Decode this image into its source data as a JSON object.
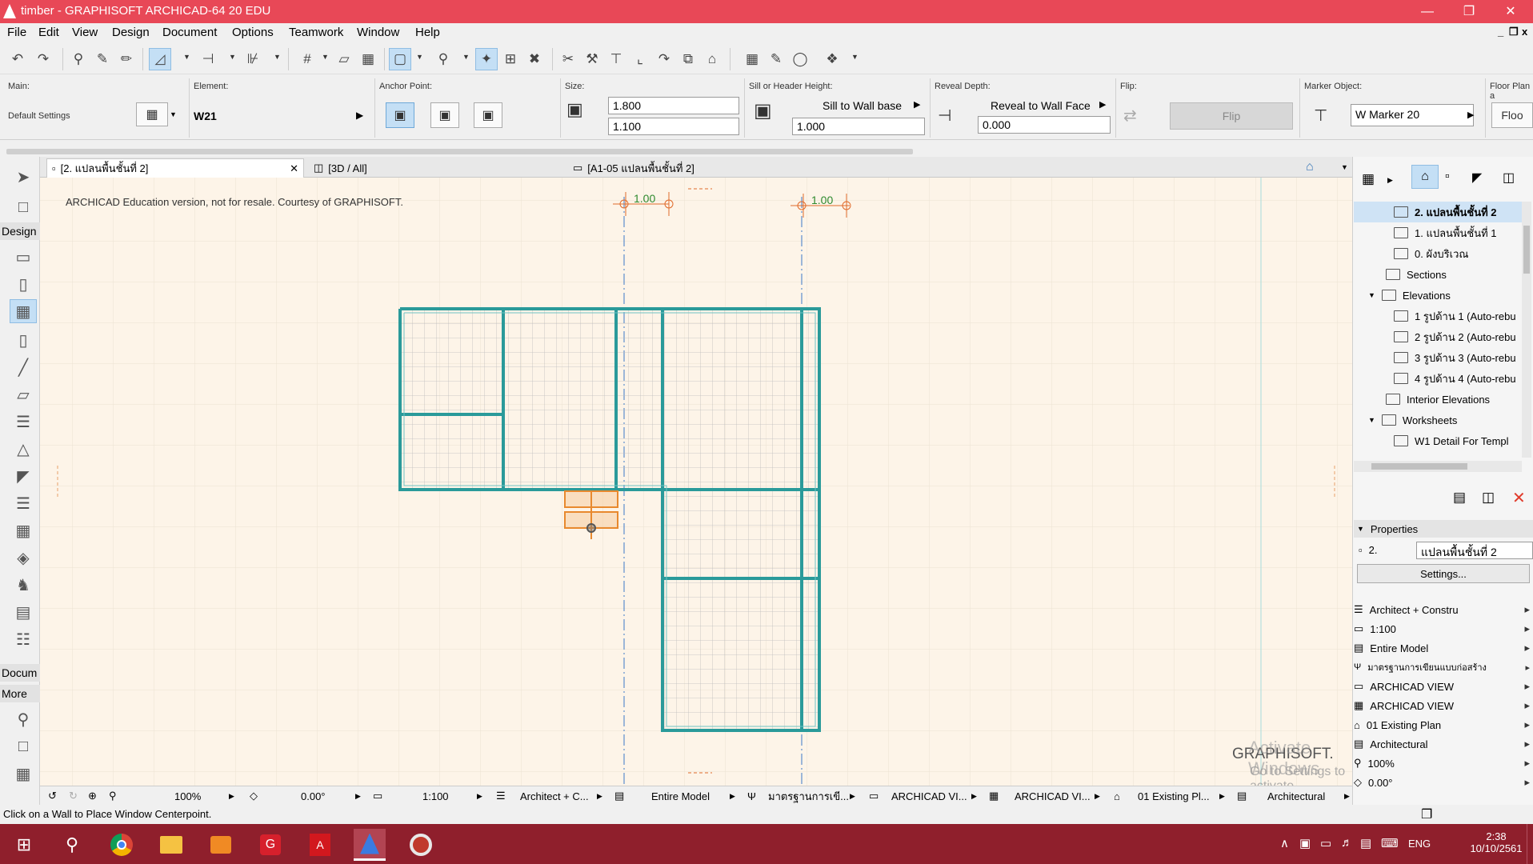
{
  "window": {
    "title": "timber - GRAPHISOFT ARCHICAD-64 20 EDU"
  },
  "menu": [
    "File",
    "Edit",
    "View",
    "Design",
    "Document",
    "Options",
    "Teamwork",
    "Window",
    "Help"
  ],
  "infobox": {
    "main_label": "Main:",
    "main_value": "Default Settings",
    "element_label": "Element:",
    "element_value": "W21",
    "anchor_label": "Anchor Point:",
    "size_label": "Size:",
    "size_width": "1.800",
    "size_height": "1.100",
    "sill_label": "Sill or Header Height:",
    "sill_mode": "Sill to Wall base",
    "sill_value": "1.000",
    "reveal_label": "Reveal Depth:",
    "reveal_mode": "Reveal to Wall Face",
    "reveal_value": "0.000",
    "flip_label": "Flip:",
    "flip_button": "Flip",
    "marker_label": "Marker Object:",
    "marker_value": "W Marker 20",
    "floorplan_label": "Floor Plan a",
    "floorplan_value": "Floo"
  },
  "tabs": [
    {
      "label": "[2. แปลนพื้นชั้นที่ 2]"
    },
    {
      "label": "[3D / All]"
    },
    {
      "label": "[A1-05 แปลนพื้นชั้นที่ 2]"
    }
  ],
  "left_sections": {
    "design": "Design",
    "document": "Docum",
    "more": "More"
  },
  "canvas": {
    "notice": "ARCHICAD Education version, not for resale. Courtesy of GRAPHISOFT.",
    "dim1": "1.00",
    "dim2": "1.00",
    "logo": "GRAPHISOFT.",
    "activate_title": "Activate Windows",
    "activate_sub": "Go to Settings to activate Windows."
  },
  "navigator": [
    {
      "label": "2. แปลนพื้นชั้นที่ 2",
      "bold": true
    },
    {
      "label": "1. แปลนพื้นชั้นที่ 1"
    },
    {
      "label": "0. ผังบริเวณ"
    },
    {
      "label": "Sections"
    },
    {
      "label": "Elevations"
    },
    {
      "label": "1 รูปด้าน 1 (Auto-rebu"
    },
    {
      "label": "2 รูปด้าน 2 (Auto-rebu"
    },
    {
      "label": "3 รูปด้าน 3 (Auto-rebu"
    },
    {
      "label": "4 รูปด้าน 4 (Auto-rebu"
    },
    {
      "label": "Interior Elevations"
    },
    {
      "label": "Worksheets"
    },
    {
      "label": "W1 Detail For Templ"
    }
  ],
  "properties": {
    "header": "Properties",
    "id": "2.",
    "name": "แปลนพื้นชั้นที่ 2",
    "settings_button": "Settings...",
    "rows": [
      "Architect + Constru",
      "1:100",
      "Entire Model",
      "มาตรฐานการเขียนแบบก่อสร้าง",
      "ARCHICAD VIEW",
      "ARCHICAD VIEW",
      "01 Existing Plan",
      "Architectural",
      "100%",
      "0.00°"
    ]
  },
  "bottom": {
    "zoom": "100%",
    "angle": "0.00°",
    "scale": "1:100",
    "layer": "Architect + C...",
    "model": "Entire Model",
    "pen": "มาตรฐานการเขี...",
    "view1": "ARCHICAD VI...",
    "view2": "ARCHICAD VI...",
    "renov": "01 Existing Pl...",
    "mvo": "Architectural"
  },
  "status": "Click on a Wall to Place Window Centerpoint.",
  "clock": {
    "time": "2:38",
    "date": "10/10/2561",
    "lang": "ENG"
  }
}
